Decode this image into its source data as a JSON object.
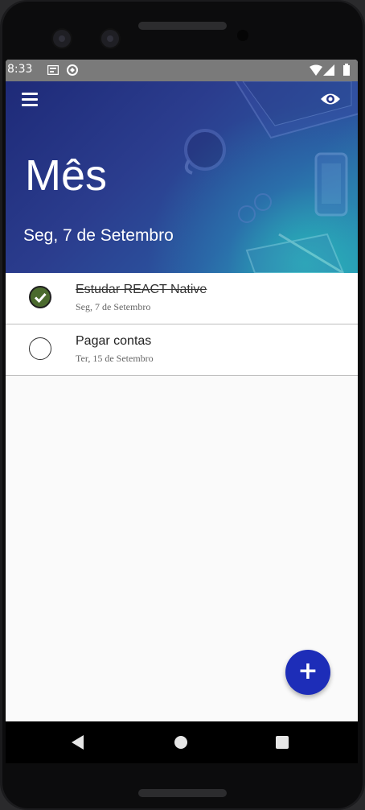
{
  "status_bar": {
    "time": "8:33"
  },
  "header": {
    "month_title": "Mês",
    "date": "Seg, 7 de Setembro"
  },
  "tasks": [
    {
      "title": "Estudar REACT Native",
      "date": "Seg, 7 de Setembro",
      "done": true
    },
    {
      "title": "Pagar contas",
      "date": "Ter, 15 de Setembro",
      "done": false
    }
  ],
  "fab": {
    "label": "+"
  },
  "icons": {
    "menu": "menu-icon",
    "visibility": "eye-icon",
    "add": "plus-icon",
    "check": "check-icon"
  },
  "colors": {
    "header_start": "#1e2a78",
    "header_end": "#2a8fb0",
    "fab": "#1d2db8",
    "check_done": "#4b6a2e"
  }
}
